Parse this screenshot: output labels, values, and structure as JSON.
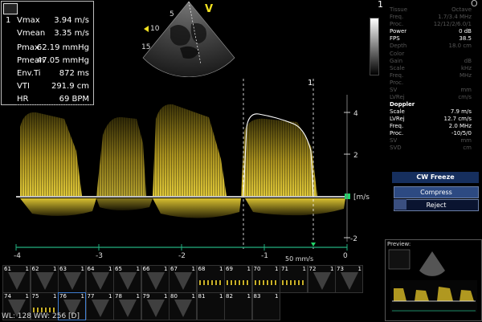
{
  "measurements": {
    "index": "1",
    "rows": [
      {
        "label": "Vmax",
        "value": "3.94 m/s"
      },
      {
        "label": "Vmean",
        "value": "3.35 m/s"
      },
      {
        "label": "Pmax",
        "value": "62.19 mmHg"
      },
      {
        "label": "Pmean",
        "value": "47.05 mmHg"
      },
      {
        "label": "Env.Ti",
        "value": "872 ms"
      },
      {
        "label": "VTI",
        "value": "291.9 cm"
      },
      {
        "label": "HR",
        "value": "69 BPM"
      }
    ]
  },
  "sector": {
    "mode_marker": "V",
    "scale_10": "10",
    "scale_15": "15",
    "scale_5": "5"
  },
  "right_panel": {
    "corner_1": "1",
    "corner_o": "O",
    "tissue": {
      "label": "Tissue",
      "value": "Octave"
    },
    "rows_top": [
      {
        "k": "Freq.",
        "v": "1.7/3.4 MHz",
        "lit": false
      },
      {
        "k": "Proc.",
        "v": "12/12/2/6.0/1",
        "lit": false
      },
      {
        "k": "Power",
        "v": "0 dB",
        "lit": true
      },
      {
        "k": "FPS",
        "v": "38.5",
        "lit": true
      },
      {
        "k": "Depth",
        "v": "18.0 cm",
        "lit": false
      }
    ],
    "color_title": "Color",
    "rows_color": [
      {
        "k": "Gain",
        "v": "dB"
      },
      {
        "k": "Scale",
        "v": "kHz"
      },
      {
        "k": "Freq.",
        "v": "MHz"
      },
      {
        "k": "Proc.",
        "v": ""
      },
      {
        "k": "SV",
        "v": "mm"
      },
      {
        "k": "LVRej",
        "v": "cm/s"
      }
    ],
    "doppler_title": "Doppler",
    "rows_doppler": [
      {
        "k": "Scale",
        "v": "7.9 m/s",
        "lit": true
      },
      {
        "k": "LVRej",
        "v": "12.7 cm/s",
        "lit": true
      },
      {
        "k": "Freq.",
        "v": "2.0 MHz",
        "lit": true
      },
      {
        "k": "Proc.",
        "v": "-10/5/0",
        "lit": true
      },
      {
        "k": "SV",
        "v": "mm",
        "lit": false
      },
      {
        "k": "SVD",
        "v": "cm",
        "lit": false
      }
    ]
  },
  "freeze_menu": {
    "title": "CW Freeze",
    "compress": "Compress",
    "reject": "Reject"
  },
  "doppler": {
    "cursor_label": "1",
    "unit": "[m/s]",
    "speed": "50 mm/s",
    "y_ticks": [
      "4",
      "2",
      "-2"
    ],
    "x_ticks": [
      "-4",
      "-3",
      "-2",
      "-1",
      "0"
    ]
  },
  "thumbnails": {
    "row1": [
      "61",
      "62",
      "63",
      "64",
      "65",
      "66",
      "67",
      "68",
      "69",
      "70",
      "71",
      "72",
      "73"
    ],
    "row2": [
      "74",
      "75",
      "76",
      "77",
      "78",
      "79",
      "80",
      "81",
      "82",
      "83"
    ],
    "frame_count": "1",
    "selected": "76",
    "doppler_thumbs": [
      "68",
      "69",
      "70",
      "71",
      "75"
    ],
    "blank_thumbs": [
      "81",
      "82",
      "83"
    ]
  },
  "status": {
    "text": "WL: 128 WW: 256 [D]"
  },
  "preview": {
    "title": "Preview:"
  },
  "colors": {
    "accent": "#f0e020",
    "doppler_yellow": "#c9b028",
    "baseline_green": "#22d46a",
    "menu_blue": "#162f5e"
  }
}
